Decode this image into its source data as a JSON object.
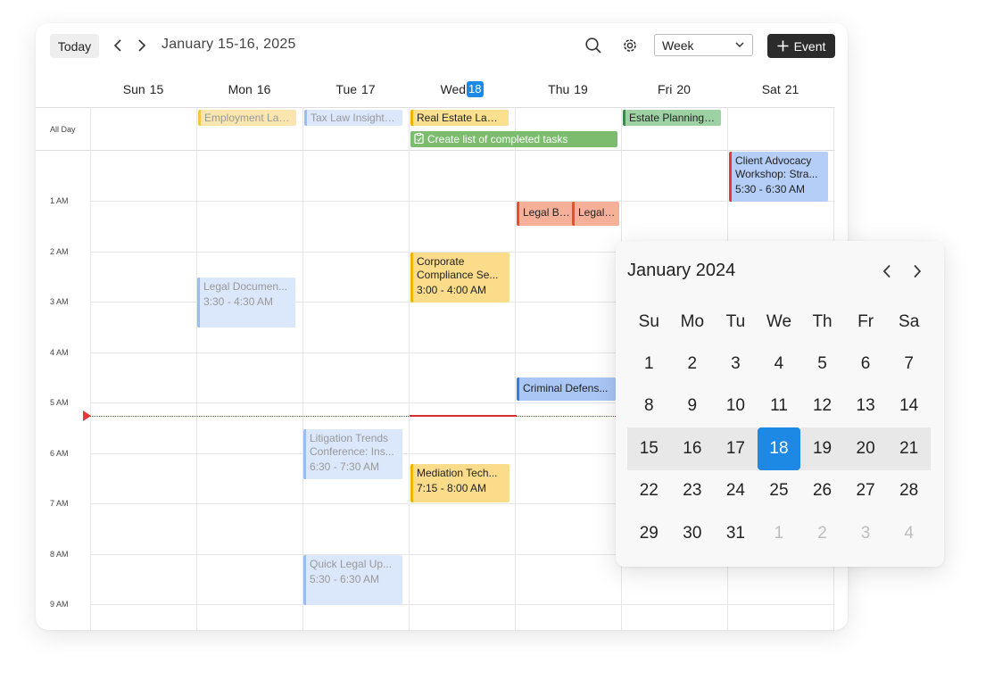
{
  "toolbar": {
    "today_label": "Today",
    "range_title": "January 15-16, 2025",
    "view_select": "Week",
    "event_button": "Event"
  },
  "days": [
    {
      "name": "Sun",
      "num": "15",
      "today": false
    },
    {
      "name": "Mon",
      "num": "16",
      "today": false
    },
    {
      "name": "Tue",
      "num": "17",
      "today": false
    },
    {
      "name": "Wed",
      "num": "18",
      "today": true
    },
    {
      "name": "Thu",
      "num": "19",
      "today": false
    },
    {
      "name": "Fri",
      "num": "20",
      "today": false
    },
    {
      "name": "Sat",
      "num": "21",
      "today": false
    }
  ],
  "allday_label": "All Day",
  "hour_labels": [
    "1 AM",
    "2 AM",
    "3 AM",
    "4 AM",
    "5 AM",
    "6 AM",
    "7 AM",
    "8 AM",
    "9 AM"
  ],
  "allday_events": [
    {
      "title": "Employment Law S",
      "day": 1,
      "color": "#fbe6b0",
      "border": "#f5c54a",
      "text": "#999999"
    },
    {
      "title": "Tax Law Insights: S",
      "day": 2,
      "color": "#dbe7fb",
      "border": "#9bbcf2",
      "text": "#999999"
    },
    {
      "title": "Real Estate Law W",
      "day": 3,
      "color": "#fbe08f",
      "border": "#f0b400",
      "text": "#222222"
    },
    {
      "title": "Estate Planning Es",
      "day": 5,
      "color": "#9ed1a3",
      "border": "#3a8a48",
      "text": "#222222"
    }
  ],
  "task": {
    "title": "Create list of completed tasks",
    "color": "#7cbc6e"
  },
  "events": [
    {
      "title": "Client Advocacy Workshop: Stra...",
      "time": "5:30 - 6:30 AM",
      "color": "#b4cef8",
      "border": "#e53935",
      "text": "#222222"
    },
    {
      "title": "Legal Brie",
      "time": "",
      "color": "#f6b09a",
      "border": "#e6502a",
      "text": "#222222"
    },
    {
      "title": "Legal Ins",
      "time": "",
      "color": "#f6b09a",
      "border": "#e6502a",
      "text": "#222222"
    },
    {
      "title": "Corporate Compliance Se...",
      "time": "3:00 - 4:00 AM",
      "color": "#fbdc8a",
      "border": "#f0b400",
      "text": "#222222"
    },
    {
      "title": "Legal Documen...",
      "time": "3:30 - 4:30 AM",
      "color": "#dbe7fb",
      "border": "#9bbcf2",
      "text": "#999999"
    },
    {
      "title": "Criminal Defens...",
      "time": "",
      "color": "#a9c6f5",
      "border": "#3a7be0",
      "text": "#222222"
    },
    {
      "title": "Litigation Trends Conference: Ins...",
      "time": "6:30 - 7:30 AM",
      "color": "#dbe7fb",
      "border": "#9bbcf2",
      "text": "#999999"
    },
    {
      "title": "Mediation Tech...",
      "time": "7:15 - 8:00 AM",
      "color": "#fbdc8a",
      "border": "#f0b400",
      "text": "#222222"
    },
    {
      "title": "Quick Legal Up...",
      "time": "5:30 - 6:30 AM",
      "color": "#dbe7fb",
      "border": "#9bbcf2",
      "text": "#999999"
    }
  ],
  "mini_calendar": {
    "title": "January 2024",
    "weekdays": [
      "Su",
      "Mo",
      "Tu",
      "We",
      "Th",
      "Fr",
      "Sa"
    ],
    "weeks": [
      [
        "1",
        "2",
        "3",
        "4",
        "5",
        "6",
        "7"
      ],
      [
        "8",
        "9",
        "10",
        "11",
        "12",
        "13",
        "14"
      ],
      [
        "15",
        "16",
        "17",
        "18",
        "19",
        "20",
        "21"
      ],
      [
        "22",
        "23",
        "24",
        "25",
        "26",
        "27",
        "28"
      ],
      [
        "29",
        "30",
        "31",
        "1",
        "2",
        "3",
        "4"
      ]
    ],
    "selected_day": "18",
    "highlight_week": 2,
    "muted_cells": [
      [
        4,
        3
      ],
      [
        4,
        4
      ],
      [
        4,
        5
      ],
      [
        4,
        6
      ]
    ]
  }
}
